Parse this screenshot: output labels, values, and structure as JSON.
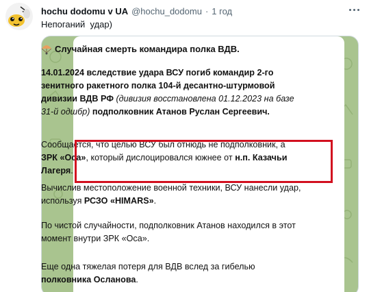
{
  "author": {
    "name": "hochu dodomu v UA",
    "handle": "@hochu_dodomu",
    "separator": "·",
    "time": "1 год"
  },
  "tweet": {
    "text": "Непоганий  удар)"
  },
  "icons": {
    "avatar": "cartoon-character-avatar",
    "more": "more-icon",
    "title_emoji": "parachute-icon"
  },
  "colors": {
    "highlight_box": "#d2101f",
    "chat_background": "#a9c48f",
    "handle": "#536471"
  },
  "post": {
    "title": "Случайная смерть командира полка ВДВ.",
    "p1": {
      "date_lead": "14.01.2024 вследствие удара ВСУ погиб командир 2-го зенитного ракетного полка 104-й десантно-штурмовой дивизии ВДВ РФ",
      "note": "(дивизия восстановлена 01.12.2023 на базе 31-й одшбр)",
      "tail": "подполковник Атанов Руслан Сергеевич."
    },
    "p2": {
      "a": "Сообщается, что целью ВСУ был отнюдь не подполковник, а",
      "zrk": "ЗРК «Оса»",
      "b": ", который дислоцировался южнее от",
      "place": "н.п. Казачьи Лагеря",
      "c": "."
    },
    "p3": {
      "a": "Вычислив местоположение военной техники, ВСУ нанесли удар, используя",
      "rszo": "РСЗО «HIMARS»",
      "b": "."
    },
    "p4": "По чистой случайности, подполковник Атанов находился в этот момент внутри ЗРК «Оса».",
    "p5": {
      "a": "Еще одна тяжелая потеря для ВДВ вслед за гибелью",
      "name": "полковника Осланова",
      "b": "."
    }
  }
}
